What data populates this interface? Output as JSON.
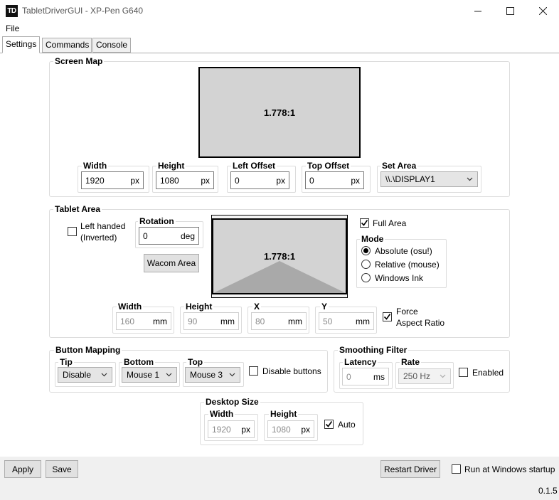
{
  "window": {
    "icon_text": "TD",
    "title": "TabletDriverGUI - XP-Pen G640",
    "minimize_glyph": "—",
    "maximize_glyph": "☐",
    "close_glyph": "✕"
  },
  "menu": {
    "file": "File"
  },
  "tabs": [
    {
      "label": "Settings",
      "active": true
    },
    {
      "label": "Commands",
      "active": false
    },
    {
      "label": "Console",
      "active": false
    }
  ],
  "screen_map": {
    "title": "Screen Map",
    "ratio": "1.778:1",
    "width": {
      "label": "Width",
      "value": "1920",
      "unit": "px"
    },
    "height": {
      "label": "Height",
      "value": "1080",
      "unit": "px"
    },
    "left_offset": {
      "label": "Left Offset",
      "value": "0",
      "unit": "px"
    },
    "top_offset": {
      "label": "Top Offset",
      "value": "0",
      "unit": "px"
    },
    "set_area": {
      "label": "Set Area",
      "value": "\\\\.\\DISPLAY1"
    }
  },
  "tablet_area": {
    "title": "Tablet Area",
    "left_handed": "Left handed",
    "inverted": "(Inverted)",
    "rotation": {
      "label": "Rotation",
      "value": "0",
      "unit": "deg"
    },
    "wacom_button": "Wacom Area",
    "ratio": "1.778:1",
    "full_area": "Full Area",
    "full_area_checked": true,
    "mode": {
      "label": "Mode",
      "options": [
        "Absolute (osu!)",
        "Relative (mouse)",
        "Windows Ink"
      ],
      "selected": 0
    },
    "width": {
      "label": "Width",
      "value": "160",
      "unit": "mm"
    },
    "height": {
      "label": "Height",
      "value": "90",
      "unit": "mm"
    },
    "x": {
      "label": "X",
      "value": "80",
      "unit": "mm"
    },
    "y": {
      "label": "Y",
      "value": "50",
      "unit": "mm"
    },
    "force_aspect": "Force",
    "force_aspect_2": "Aspect Ratio",
    "force_aspect_checked": true
  },
  "button_mapping": {
    "title": "Button Mapping",
    "tip": {
      "label": "Tip",
      "value": "Disable"
    },
    "bottom": {
      "label": "Bottom",
      "value": "Mouse 1"
    },
    "top": {
      "label": "Top",
      "value": "Mouse 3"
    },
    "disable_buttons": "Disable buttons"
  },
  "smoothing": {
    "title": "Smoothing Filter",
    "latency": {
      "label": "Latency",
      "value": "0",
      "unit": "ms"
    },
    "rate": {
      "label": "Rate",
      "value": "250 Hz"
    },
    "enabled": "Enabled"
  },
  "desktop_size": {
    "title": "Desktop Size",
    "width": {
      "label": "Width",
      "value": "1920",
      "unit": "px"
    },
    "height": {
      "label": "Height",
      "value": "1080",
      "unit": "px"
    },
    "auto": "Auto",
    "auto_checked": true
  },
  "bottom": {
    "apply": "Apply",
    "save": "Save",
    "restart": "Restart Driver",
    "run_startup": "Run at Windows startup",
    "version": "0.1.5"
  }
}
